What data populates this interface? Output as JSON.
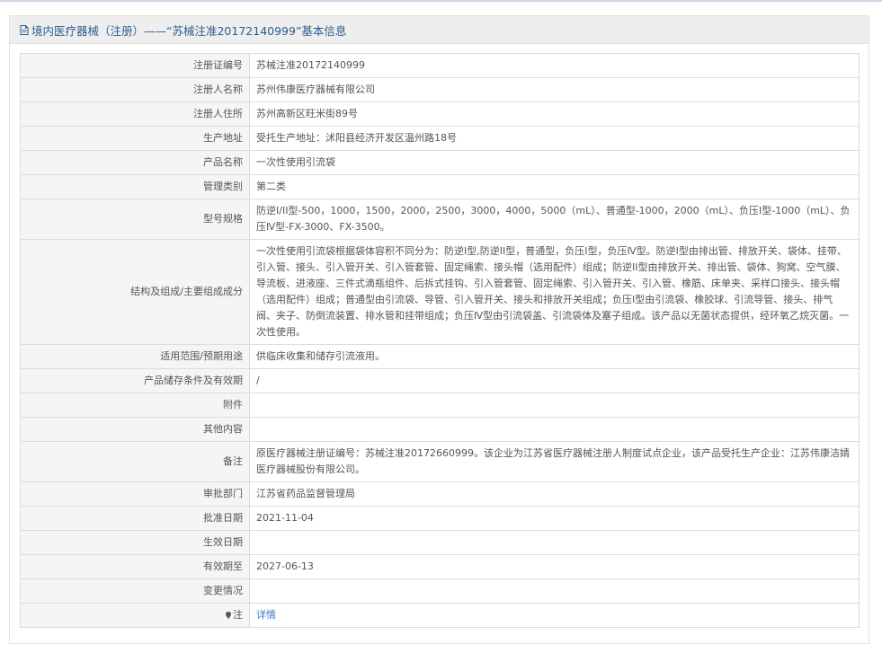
{
  "header": {
    "title": "境内医疗器械（注册）——“苏械注准20172140999”基本信息"
  },
  "rows": [
    {
      "label": "注册证编号",
      "value": "苏械注准20172140999"
    },
    {
      "label": "注册人名称",
      "value": "苏州伟康医疗器械有限公司"
    },
    {
      "label": "注册人住所",
      "value": "苏州高新区旺米街89号"
    },
    {
      "label": "生产地址",
      "value": "受托生产地址：沭阳县经济开发区温州路18号"
    },
    {
      "label": "产品名称",
      "value": "一次性使用引流袋"
    },
    {
      "label": "管理类别",
      "value": "第二类"
    },
    {
      "label": "型号规格",
      "value": "防逆I/II型-500，1000，1500，2000，2500，3000，4000，5000（mL）、普通型-1000，2000（mL）、负压Ⅰ型-1000（mL）、负压Ⅳ型-FX-3000、FX-3500。"
    },
    {
      "label": "结构及组成/主要组成成分",
      "value": "一次性使用引流袋根据袋体容积不同分为：防逆I型,防逆II型，普通型，负压Ⅰ型，负压Ⅳ型。防逆I型由排出管、排放开关、袋体、挂带、引入管、接头、引入管开关、引入管套管、固定绳索、接头帽（选用配件）组成；防逆II型由排放开关、排出管、袋体、狗窝、空气膜、导流板、进液座、三件式滴瓶组件、后拆式挂钩、引入管套管、固定绳索、引入管开关、引入管、橡筋、床单夹、采样口接头、接头帽（选用配件）组成；普通型由引流袋、导管、引入管开关、接头和排放开关组成；负压Ⅰ型由引流袋、橡胶球、引流导管、接头、排气阀、夹子、防倒流装置、排水管和挂带组成；负压Ⅳ型由引流袋盖、引流袋体及塞子组成。该产品以无菌状态提供，经环氧乙烷灭菌。一次性使用。"
    },
    {
      "label": "适用范围/预期用途",
      "value": "供临床收集和储存引流液用。"
    },
    {
      "label": "产品储存条件及有效期",
      "value": "/"
    },
    {
      "label": "附件",
      "value": ""
    },
    {
      "label": "其他内容",
      "value": ""
    },
    {
      "label": "备注",
      "value": "原医疗器械注册证编号：苏械注准20172660999。该企业为江苏省医疗器械注册人制度试点企业，该产品受托生产企业：江苏伟康洁婧医疗器械股份有限公司。"
    },
    {
      "label": "审批部门",
      "value": "江苏省药品监督管理局"
    },
    {
      "label": "批准日期",
      "value": "2021-11-04"
    },
    {
      "label": "生效日期",
      "value": ""
    },
    {
      "label": "有效期至",
      "value": "2027-06-13"
    },
    {
      "label": "变更情况",
      "value": ""
    }
  ],
  "note": {
    "label": "注",
    "link": "详情"
  }
}
